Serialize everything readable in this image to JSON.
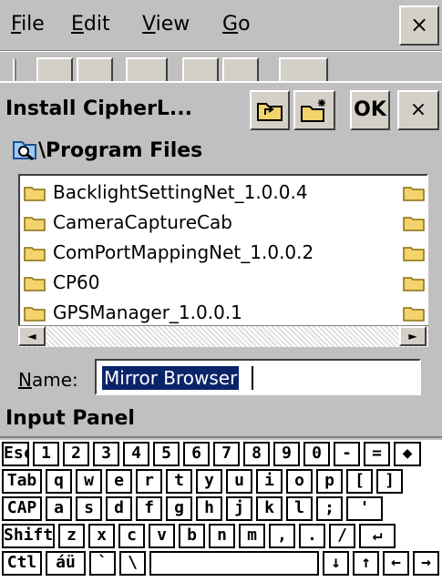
{
  "menubar": {
    "items": [
      {
        "label": "File",
        "hotkey_index": 0
      },
      {
        "label": "Edit",
        "hotkey_index": 0
      },
      {
        "label": "View",
        "hotkey_index": 0
      },
      {
        "label": "Go",
        "hotkey_index": 0
      }
    ],
    "close_label": "×"
  },
  "dialog": {
    "title": "Install CipherL...",
    "ok_label": "OK",
    "close_label": "×",
    "path": "\\Program Files",
    "files": [
      "BacklightSettingNet_1.0.0.4",
      "CameraCaptureCab",
      "ComPortMappingNet_1.0.0.2",
      "CP60",
      "GPSManager_1.0.0.1"
    ],
    "name_label": "Name:",
    "name_value": "Mirror Browser",
    "scroll_left": "◄",
    "scroll_right": "►"
  },
  "input_panel": {
    "title": "Input Panel",
    "rows": [
      [
        "Esc",
        "1",
        "2",
        "3",
        "4",
        "5",
        "6",
        "7",
        "8",
        "9",
        "0",
        "-",
        "=",
        "◆"
      ],
      [
        "Tab",
        "q",
        "w",
        "e",
        "r",
        "t",
        "y",
        "u",
        "i",
        "o",
        "p",
        "[",
        "]"
      ],
      [
        "CAP",
        "a",
        "s",
        "d",
        "f",
        "g",
        "h",
        "j",
        "k",
        "l",
        ";",
        "'"
      ],
      [
        "Shift",
        "z",
        "x",
        "c",
        "v",
        "b",
        "n",
        "m",
        ",",
        ".",
        "/",
        "↵"
      ],
      [
        "Ctl",
        "áü",
        "`",
        "\\",
        "",
        "↓",
        "↑",
        "←",
        "→"
      ]
    ]
  },
  "colors": {
    "chrome": "#c0c0c0",
    "selection": "#0a246a",
    "folder": "#f3d36b"
  }
}
